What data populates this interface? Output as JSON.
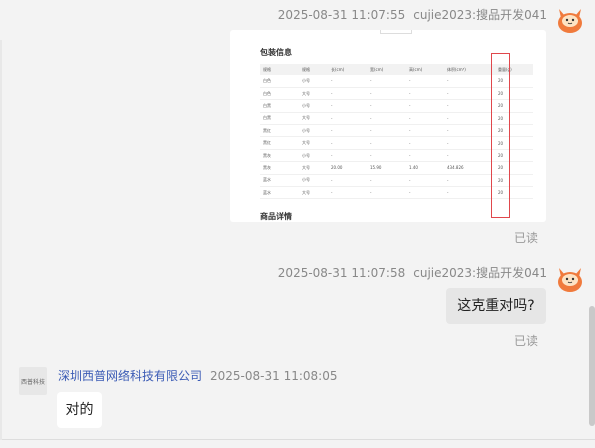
{
  "messages": [
    {
      "timestamp": "2025-08-31 11:07:55",
      "sender": "cujie2023:搜品开发041",
      "type": "image",
      "image": {
        "section_title": "包装信息",
        "footer_title": "商品详情",
        "columns": [
          "规格",
          "规格",
          "长(cm)",
          "宽(cm)",
          "高(cm)",
          "体积(cm³)",
          "重量(g)"
        ],
        "rows": [
          [
            "白色",
            "小号",
            "-",
            "-",
            "-",
            "-",
            "20"
          ],
          [
            "白色",
            "大号",
            "-",
            "-",
            "-",
            "-",
            "20"
          ],
          [
            "白黑",
            "小号",
            "-",
            "-",
            "-",
            "-",
            "20"
          ],
          [
            "白黑",
            "大号",
            "-",
            "-",
            "-",
            "-",
            "20"
          ],
          [
            "黑红",
            "小号",
            "-",
            "-",
            "-",
            "-",
            "20"
          ],
          [
            "黑红",
            "大号",
            "-",
            "-",
            "-",
            "-",
            "20"
          ],
          [
            "黑灰",
            "小号",
            "-",
            "-",
            "-",
            "-",
            "20"
          ],
          [
            "黑灰",
            "大号",
            "20.00",
            "15.90",
            "1.40",
            "434.826",
            "20"
          ],
          [
            "蓝水",
            "小号",
            "-",
            "-",
            "-",
            "-",
            "20"
          ],
          [
            "蓝水",
            "大号",
            "-",
            "-",
            "-",
            "-",
            "20"
          ]
        ]
      },
      "status": "已读"
    },
    {
      "timestamp": "2025-08-31 11:07:58",
      "sender": "cujie2023:搜品开发041",
      "type": "text",
      "text": "这克重对吗?",
      "status": "已读"
    },
    {
      "timestamp": "2025-08-31 11:08:05",
      "sender": "深圳西普网络科技有限公司",
      "avatar_text": "西普科技",
      "type": "text",
      "text": "对的"
    }
  ],
  "colors": {
    "background": "#f3f3f3",
    "company_name": "#3b5bb5",
    "highlight_box": "#e0474c",
    "avatar_orange": "#f07a3c"
  },
  "icons": {
    "sender_avatar": "cartoon-cat-avatar-icon"
  }
}
